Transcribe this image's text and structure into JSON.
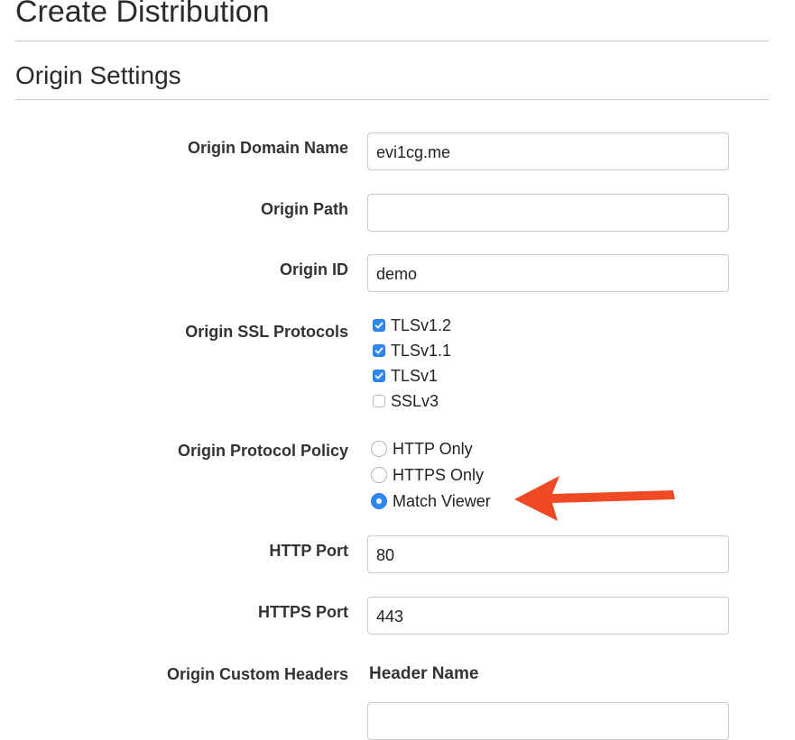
{
  "page_title": "Create Distribution",
  "section_title": "Origin Settings",
  "fields": {
    "origin_domain_name": {
      "label": "Origin Domain Name",
      "value": "evi1cg.me"
    },
    "origin_path": {
      "label": "Origin Path",
      "value": ""
    },
    "origin_id": {
      "label": "Origin ID",
      "value": "demo"
    },
    "http_port": {
      "label": "HTTP Port",
      "value": "80"
    },
    "https_port": {
      "label": "HTTPS Port",
      "value": "443"
    }
  },
  "ssl_protocols": {
    "label": "Origin SSL Protocols",
    "options": [
      {
        "label": "TLSv1.2",
        "checked": true
      },
      {
        "label": "TLSv1.1",
        "checked": true
      },
      {
        "label": "TLSv1",
        "checked": true
      },
      {
        "label": "SSLv3",
        "checked": false
      }
    ]
  },
  "protocol_policy": {
    "label": "Origin Protocol Policy",
    "options": [
      {
        "label": "HTTP Only",
        "selected": false
      },
      {
        "label": "HTTPS Only",
        "selected": false
      },
      {
        "label": "Match Viewer",
        "selected": true
      }
    ]
  },
  "custom_headers": {
    "label": "Origin Custom Headers",
    "column_header": "Header Name",
    "header_name_value": ""
  },
  "colors": {
    "checkbox_accent": "#2f88f0",
    "arrow": "#f04a25"
  },
  "icons": {
    "annotation": "arrow-left-icon",
    "checkmark": "checkmark-icon"
  }
}
